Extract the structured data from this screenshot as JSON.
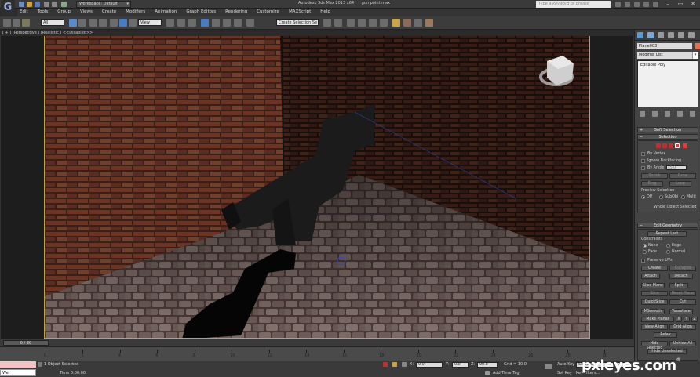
{
  "titlebar": {
    "workspace": "Workspace: Default",
    "app_title": "Autodesk 3ds Max  2013 x64",
    "file_name": "gun point.max",
    "search_placeholder": "Type a keyword or phrase"
  },
  "menus": [
    "Edit",
    "Tools",
    "Group",
    "Views",
    "Create",
    "Modifiers",
    "Animation",
    "Graph Editors",
    "Rendering",
    "Customize",
    "MAXScript",
    "Help"
  ],
  "toolbar": {
    "selection_filter": "All",
    "ref_coord": "View",
    "named_selection": "Create Selection Se"
  },
  "viewport": {
    "label": "[ + ] [Perspective ] [Realistic ]  <<Disabled>>"
  },
  "command_panel": {
    "object_name": "Plane003",
    "modifier_list": "Modifier List",
    "stack_items": [
      "Editable Poly"
    ],
    "soft_selection": "Soft Selection",
    "selection": {
      "title": "Selection",
      "by_vertex": "By Vertex",
      "ignore_backfacing": "Ignore Backfacing",
      "by_angle": "By Angle:",
      "by_angle_value": "45.0",
      "shrink": "Shrink",
      "grow": "Grow",
      "ring": "Ring",
      "loop": "Loop",
      "preview_selection": "Preview Selection",
      "preview_off": "Off",
      "preview_subobj": "SubObj",
      "preview_multi": "Multi",
      "whole_object_selected": "Whole Object Selected"
    },
    "edit_geometry": {
      "title": "Edit Geometry",
      "repeat_last": "Repeat Last",
      "constraints": "Constraints",
      "none": "None",
      "edge": "Edge",
      "face": "Face",
      "normal": "Normal",
      "preserve_uvs": "Preserve UVs",
      "create": "Create",
      "collapse": "Collapse",
      "attach": "Attach",
      "detach": "Detach",
      "slice_plane": "Slice Plane",
      "split": "Split",
      "slice": "Slice",
      "reset_plane": "Reset Plane",
      "quickslice": "QuickSlice",
      "cut": "Cut",
      "msmooth": "MSmooth",
      "tessellate": "Tessellate",
      "make_planar": "Make Planar",
      "x": "X",
      "y": "Y",
      "z": "Z",
      "view_align": "View Align",
      "grid_align": "Grid Align",
      "relax": "Relax",
      "hide_selected": "Hide Selected",
      "unhide_all": "Unhide All",
      "hide_unselected": "Hide Unselected"
    }
  },
  "timeline": {
    "slider": "0 / 30",
    "ticks": [
      "0",
      "2",
      "4",
      "6",
      "8",
      "10",
      "12",
      "14",
      "16",
      "18",
      "20",
      "22",
      "24",
      "26",
      "28",
      "30"
    ]
  },
  "status": {
    "maxscript_label": "Wel",
    "selection_status": "1 Object Selected",
    "time_text": "Time  0:00:00",
    "x_label": "X:",
    "x_value": "0.0",
    "y_label": "Y:",
    "y_value": "0.0",
    "z_label": "Z:",
    "z_value": "90.0",
    "grid": "Grid = 10.0",
    "add_time_tag": "Add Time Tag",
    "auto_key": "Auto Key",
    "auto_key_value": "Selected",
    "set_key": "Set Key",
    "key_filters": "Key Filters...",
    "frame_value": "0"
  },
  "watermark": {
    "text": "pxleyes.com"
  },
  "colors": {
    "accent_viewport_border": "#bfa53a",
    "object_color": "#e07050",
    "maxscript_bg": "#f4c4c4"
  }
}
